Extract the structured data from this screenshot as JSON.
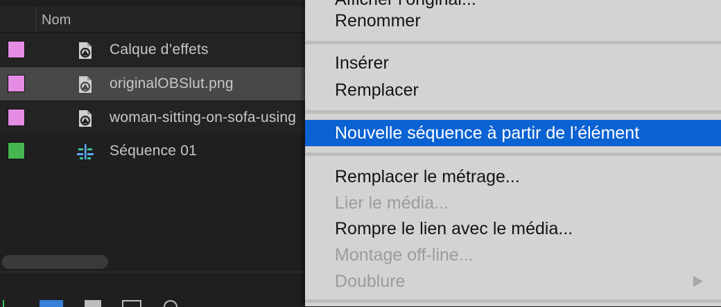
{
  "project_panel": {
    "column_header": "Nom",
    "items": [
      {
        "name": "Calque d’effets",
        "color": "#e58de4",
        "icon": "file-icon",
        "selected": false
      },
      {
        "name": "originalOBSlut.png",
        "color": "#e58de4",
        "icon": "file-icon",
        "selected": true
      },
      {
        "name": "woman-sitting-on-sofa-using",
        "color": "#e58de4",
        "icon": "file-icon",
        "selected": false
      },
      {
        "name": "Séquence 01",
        "color": "#45b652",
        "icon": "sequence-icon",
        "selected": false
      }
    ]
  },
  "context_menu": {
    "top_partial": "Afficher l’original...",
    "items": [
      {
        "label": "Renommer",
        "enabled": true
      },
      {
        "label": "Insérer",
        "enabled": true
      },
      {
        "label": "Remplacer",
        "enabled": true
      },
      {
        "label": "Nouvelle séquence à partir de l’élément",
        "enabled": true,
        "highlighted": true
      },
      {
        "label": "Remplacer le métrage...",
        "enabled": true
      },
      {
        "label": "Lier le média...",
        "enabled": false
      },
      {
        "label": "Rompre le lien avec le média...",
        "enabled": true
      },
      {
        "label": "Montage off-line...",
        "enabled": false
      },
      {
        "label": "Doublure",
        "enabled": false,
        "submenu": true
      }
    ],
    "highlight_color": "#0b62d2"
  }
}
